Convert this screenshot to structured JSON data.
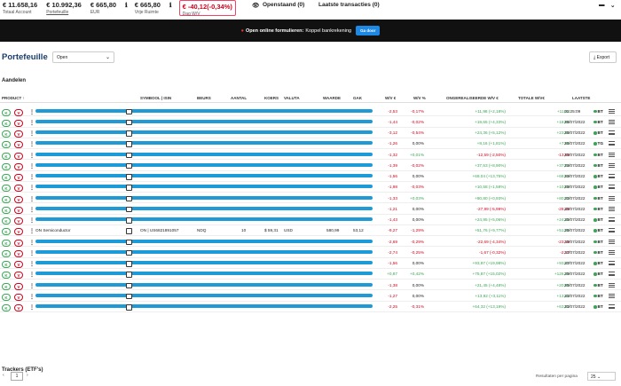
{
  "stats": [
    {
      "value": "€ 11.658,16",
      "label": "Totaal Account"
    },
    {
      "value": "€ 10.992,36",
      "label": "Portefeuille"
    },
    {
      "value": "€ 665,80",
      "label": "EUR"
    },
    {
      "value": "€ 665,80",
      "label": "Vrije Ruimte"
    },
    {
      "value": "€ -40,12(-0,34%)",
      "label": "Dag W/V"
    }
  ],
  "top": {
    "openstaand": "Openstaand (0)",
    "laatste": "Laatste transacties (0)"
  },
  "banner": {
    "bold": "Open online formulieren:",
    "text": "Koppel bankrekening",
    "button": "Ga door"
  },
  "title": "Portefeuille",
  "filter": "Open",
  "export": "Export",
  "section_shares": "Aandelen",
  "section_trackers": "Trackers (ETF's)",
  "columns": {
    "product": "PRODUCT ↑",
    "symbol": "SYMBOOL | ISIN",
    "beurs": "BEURS",
    "aantal": "AANTAL",
    "koers": "KOERS",
    "valuta": "VALUTA",
    "waarde": "WAARDE",
    "gak": "GAK",
    "wv_eur": "W/V €",
    "wv_pct": "W/V %",
    "unrealized": "ONGEREALISEERDE W/V €",
    "total": "TOTALE W/V€",
    "last": "LAATSTE"
  },
  "rows": [
    {
      "wv": "-2,53",
      "pct": "-0,17%",
      "unreal": "+11,98 (+2,18%)",
      "total": "+11,48",
      "last": "01:25:09",
      "ex": "BT"
    },
    {
      "wv": "-1,44",
      "pct": "-0,02%",
      "unreal": "+19,65 (+4,33%)",
      "total": "+18,96",
      "last": "20/07/2022",
      "ex": "BT"
    },
    {
      "wv": "-3,12",
      "pct": "-0,54%",
      "unreal": "+24,36 (+5,12%)",
      "total": "+23,86",
      "last": "20/07/2022",
      "ex": "BT"
    },
    {
      "wv": "-1,26",
      "pct": "0,00%",
      "unreal": "+8,16 (+1,81%)",
      "total": "+7,66",
      "last": "20/07/2022",
      "ex": "TG"
    },
    {
      "wv": "-1,32",
      "pct": "+0,01%",
      "unreal": "-12,59 (-2,50%)",
      "total": "-13,59",
      "last": "20/07/2022",
      "ex": "BT"
    },
    {
      "wv": "-1,39",
      "pct": "-0,02%",
      "unreal": "+37,53 (+8,90%)",
      "total": "+37,04",
      "last": "20/07/2022",
      "ex": "BT"
    },
    {
      "wv": "-1,56",
      "pct": "0,00%",
      "unreal": "+69,04 (+13,75%)",
      "total": "+68,54",
      "last": "20/07/2022",
      "ex": "BT"
    },
    {
      "wv": "-1,98",
      "pct": "-0,03%",
      "unreal": "+10,58 (+1,58%)",
      "total": "+10,08",
      "last": "20/07/2022",
      "ex": "BT"
    },
    {
      "wv": "-1,33",
      "pct": "+0,03%",
      "unreal": "+80,80 (+0,93%)",
      "total": "+80,33",
      "last": "20/07/2022",
      "ex": "BT"
    },
    {
      "wv": "-1,21",
      "pct": "0,00%",
      "unreal": "-27,99 (-5,99%)",
      "total": "-28,49",
      "last": "20/07/2022",
      "ex": "BT"
    },
    {
      "wv": "-1,43",
      "pct": "0,00%",
      "unreal": "+24,95 (+5,06%)",
      "total": "+24,45",
      "last": "20/07/2022",
      "ex": "BT"
    },
    {
      "name": "ON Semiconductor",
      "symbol": "ON | US6821891057",
      "beurs": "NDQ",
      "aantal": "10",
      "koers": "$ 59,31",
      "valuta": "USD",
      "waarde": "580,99",
      "gak": "53,12",
      "wv": "-9,27",
      "pct": "-1,29%",
      "unreal": "+51,76 (+9,77%)",
      "total": "+51,26",
      "last": "20/07/2022",
      "ex": "BT"
    },
    {
      "wv": "-2,69",
      "pct": "-0,29%",
      "unreal": "-22,69 (-4,34%)",
      "total": "-23,19",
      "last": "20/07/2022",
      "ex": "BT"
    },
    {
      "wv": "-2,74",
      "pct": "-0,25%",
      "unreal": "-1,67 (-0,32%)",
      "total": "-2,17",
      "last": "20/07/2022",
      "ex": "BT"
    },
    {
      "wv": "-1,56",
      "pct": "0,00%",
      "unreal": "+93,97 (+19,98%)",
      "total": "+93,47",
      "last": "20/07/2022",
      "ex": "BT"
    },
    {
      "wv": "+0,87",
      "pct": "+0,42%",
      "unreal": "+75,87 (+15,02%)",
      "total": "+126,39",
      "last": "20/07/2022",
      "ex": "BT"
    },
    {
      "wv": "-1,38",
      "pct": "0,00%",
      "unreal": "+21,45 (+4,48%)",
      "total": "+20,95",
      "last": "20/07/2022",
      "ex": "BT"
    },
    {
      "wv": "-1,27",
      "pct": "0,00%",
      "unreal": "+13,92 (+3,11%)",
      "total": "+13,42",
      "last": "20/07/2022",
      "ex": "BT"
    },
    {
      "wv": "-2,25",
      "pct": "-0,31%",
      "unreal": "+64,32 (+13,19%)",
      "total": "+63,82",
      "last": "20/07/2022",
      "ex": "BT"
    }
  ],
  "pager": {
    "page": "1",
    "rpp_label": "Resultaten per pagina",
    "rpp": "25"
  },
  "accent": "#1e9bd7"
}
